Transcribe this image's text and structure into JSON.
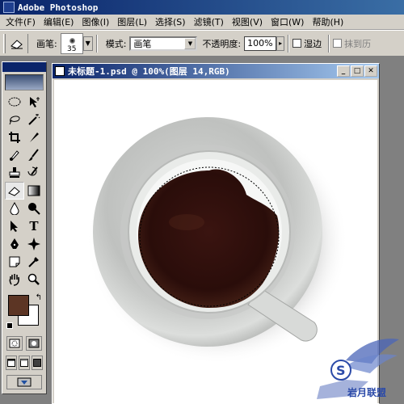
{
  "app": {
    "title": "Adobe Photoshop"
  },
  "menu": {
    "items": [
      "文件(F)",
      "编辑(E)",
      "图像(I)",
      "图层(L)",
      "选择(S)",
      "滤镜(T)",
      "视图(V)",
      "窗口(W)",
      "帮助(H)"
    ]
  },
  "options": {
    "brush_label": "画笔:",
    "brush_size": "35",
    "mode_label": "模式:",
    "mode_value": "画笔",
    "opacity_label": "不透明度:",
    "opacity_value": "100%",
    "wet_edges_label": "湿边",
    "erase_history_label": "抹到历"
  },
  "document": {
    "title": "未标题-1.psd @ 100%(图层 14,RGB)"
  },
  "colors": {
    "foreground": "#5c3524",
    "background": "#ffffff",
    "title_bar": "#0a246a",
    "chrome": "#d4d0c8"
  },
  "watermark": {
    "text": "岩月联盟"
  }
}
